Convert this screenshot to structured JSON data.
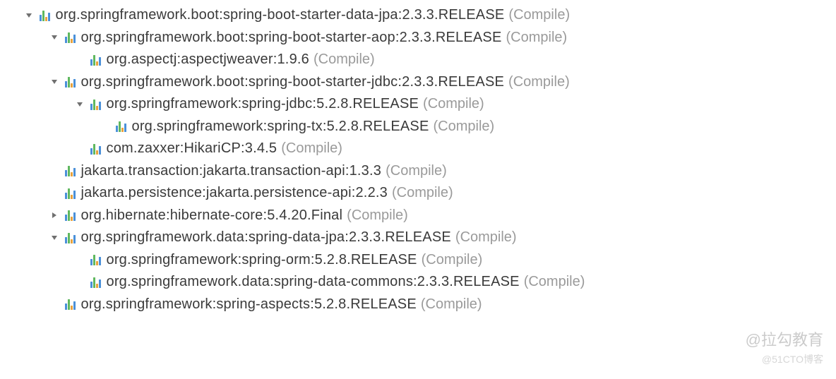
{
  "scopeLabel": "(Compile)",
  "rows": [
    {
      "depth": 0,
      "expand": "open",
      "pkg": "org.springframework.boot:spring-boot-starter-data-jpa:2.3.3.RELEASE"
    },
    {
      "depth": 1,
      "expand": "open",
      "pkg": "org.springframework.boot:spring-boot-starter-aop:2.3.3.RELEASE"
    },
    {
      "depth": 2,
      "expand": "none",
      "pkg": "org.aspectj:aspectjweaver:1.9.6"
    },
    {
      "depth": 1,
      "expand": "open",
      "pkg": "org.springframework.boot:spring-boot-starter-jdbc:2.3.3.RELEASE"
    },
    {
      "depth": 2,
      "expand": "open",
      "pkg": "org.springframework:spring-jdbc:5.2.8.RELEASE"
    },
    {
      "depth": 3,
      "expand": "none",
      "pkg": "org.springframework:spring-tx:5.2.8.RELEASE"
    },
    {
      "depth": 2,
      "expand": "none",
      "pkg": "com.zaxxer:HikariCP:3.4.5"
    },
    {
      "depth": 1,
      "expand": "none",
      "pkg": "jakarta.transaction:jakarta.transaction-api:1.3.3"
    },
    {
      "depth": 1,
      "expand": "none",
      "pkg": "jakarta.persistence:jakarta.persistence-api:2.2.3"
    },
    {
      "depth": 1,
      "expand": "closed",
      "pkg": "org.hibernate:hibernate-core:5.4.20.Final"
    },
    {
      "depth": 1,
      "expand": "open",
      "pkg": "org.springframework.data:spring-data-jpa:2.3.3.RELEASE"
    },
    {
      "depth": 2,
      "expand": "none",
      "pkg": "org.springframework:spring-orm:5.2.8.RELEASE"
    },
    {
      "depth": 2,
      "expand": "none",
      "pkg": "org.springframework.data:spring-data-commons:2.3.3.RELEASE"
    },
    {
      "depth": 1,
      "expand": "none",
      "pkg": "org.springframework:spring-aspects:5.2.8.RELEASE"
    }
  ],
  "watermark1": "@拉勾教育",
  "watermark2": "@51CTO博客"
}
